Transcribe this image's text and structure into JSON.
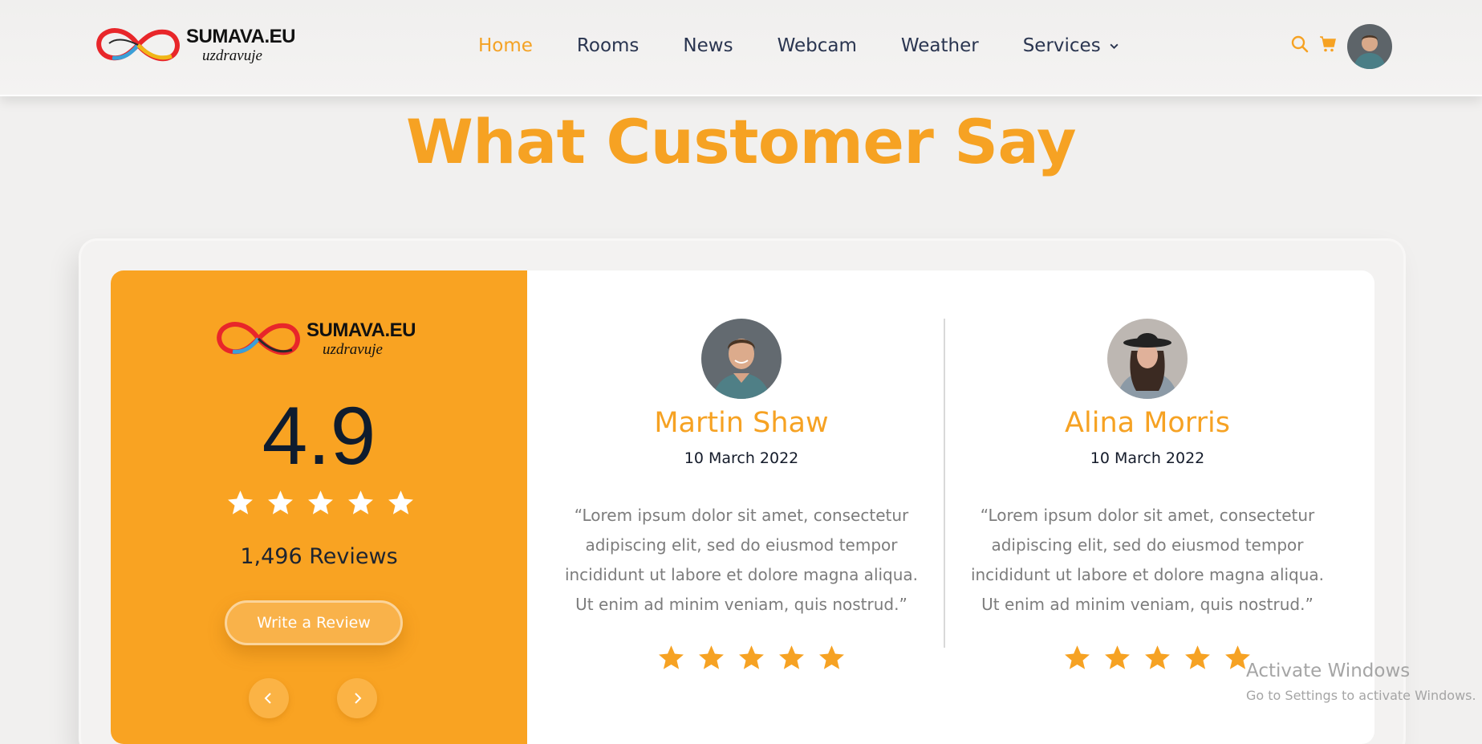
{
  "brand": {
    "name": "SUMAVA.EU",
    "tagline": "uzdravuje"
  },
  "nav": {
    "items": [
      {
        "label": "Home",
        "active": true
      },
      {
        "label": "Rooms",
        "active": false
      },
      {
        "label": "News",
        "active": false
      },
      {
        "label": "Webcam",
        "active": false
      },
      {
        "label": "Weather",
        "active": false
      },
      {
        "label": "Services",
        "active": false,
        "has_dropdown": true
      }
    ]
  },
  "header_icons": [
    "search-icon",
    "cart-icon",
    "user-avatar"
  ],
  "title": "What Customer Say",
  "summary": {
    "rating": "4.9",
    "stars": 5,
    "reviews_count": "1,496 Reviews",
    "write_review_label": "Write a Review",
    "prev_icon": "chevron-left-icon",
    "next_icon": "chevron-right-icon"
  },
  "reviews": [
    {
      "name": "Martin Shaw",
      "date": "10 March 2022",
      "text": "“Lorem ipsum dolor sit amet, consectetur adipiscing elit, sed do eiusmod tempor incididunt ut labore et dolore magna aliqua. Ut enim ad minim veniam, quis nostrud.”",
      "stars": 5
    },
    {
      "name": "Alina Morris",
      "date": "10 March 2022",
      "text": "“Lorem ipsum dolor sit amet, consectetur adipiscing elit, sed do eiusmod tempor incididunt ut labore et dolore magna aliqua. Ut enim ad minim veniam, quis nostrud.”",
      "stars": 5
    }
  ],
  "watermark": {
    "title": "Activate Windows",
    "subtitle": "Go to Settings to activate Windows."
  },
  "colors": {
    "accent": "#f6a223",
    "panel": "#f9a322",
    "dark_text": "#0f1c2e",
    "muted_text": "#7c7c7c",
    "background": "#f1f0ef"
  }
}
